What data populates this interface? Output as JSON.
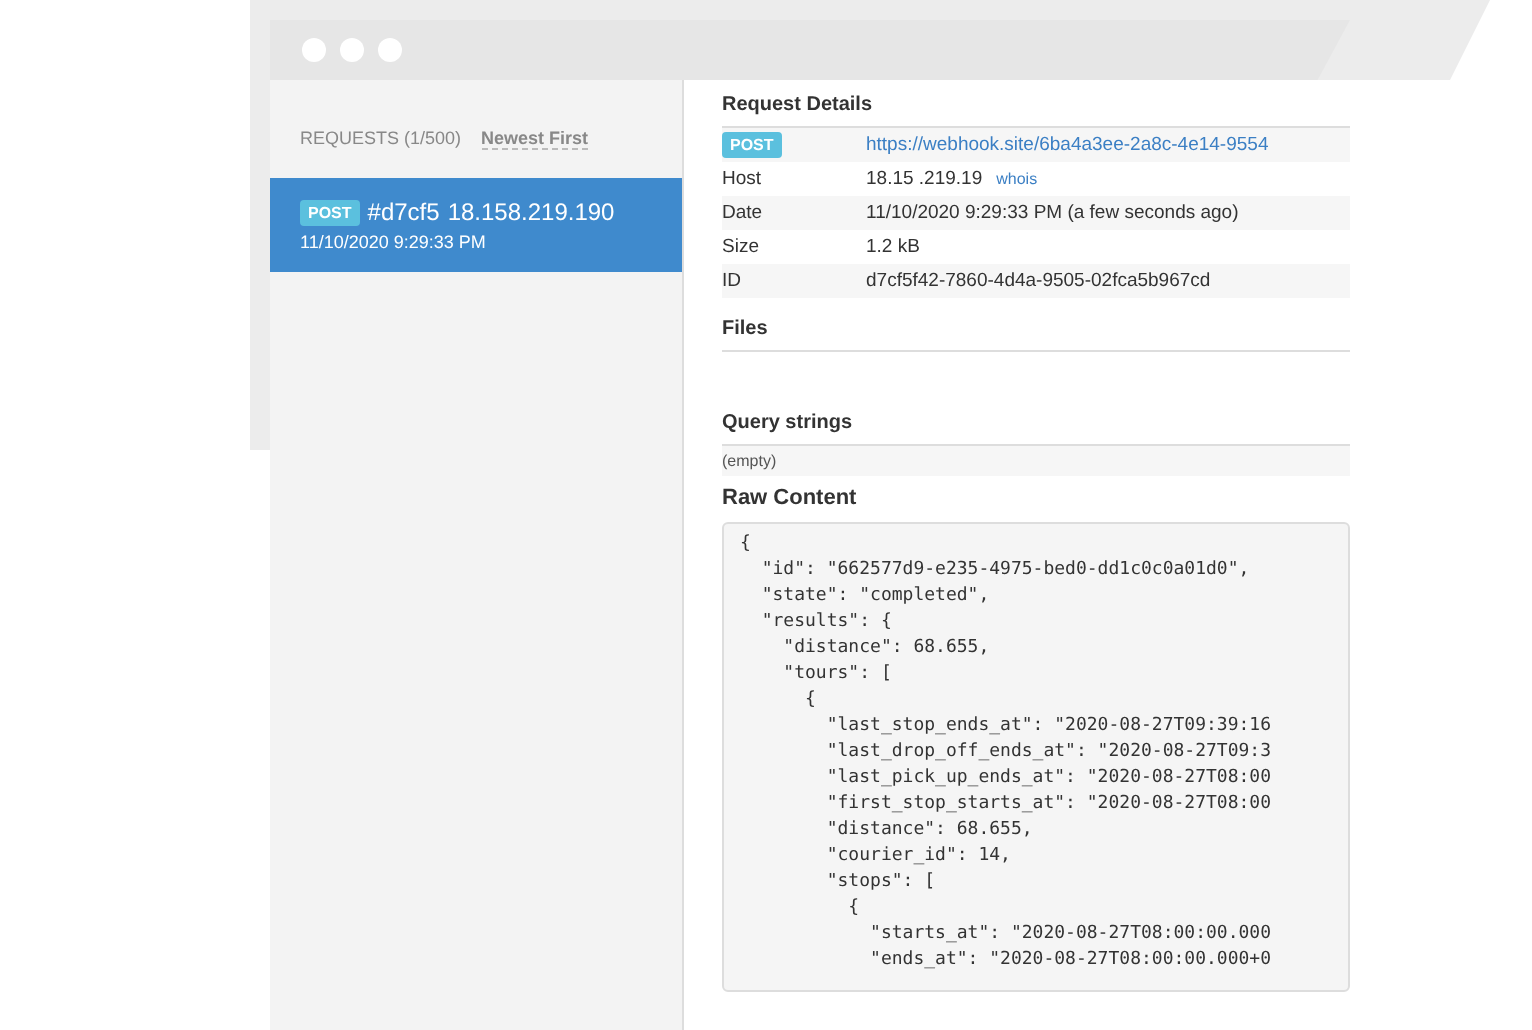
{
  "sidebar": {
    "title": "REQUESTS (1/500)",
    "sort": "Newest First",
    "requests": [
      {
        "method": "POST",
        "id": "#d7cf5",
        "ip": "18.158.219.190",
        "time": "11/10/2020 9:29:33 PM",
        "selected": true
      }
    ]
  },
  "details": {
    "title": "Request Details",
    "method": "POST",
    "url": "https://webhook.site/6ba4a3ee-2a8c-4e14-9554",
    "rows": [
      {
        "label": "Host",
        "value": "18.15 .219.19",
        "link": "whois"
      },
      {
        "label": "Date",
        "value": "11/10/2020 9:29:33 PM (a few seconds ago)"
      },
      {
        "label": "Size",
        "value": "1.2 kB"
      },
      {
        "label": "ID",
        "value": "d7cf5f42-7860-4d4a-9505-02fca5b967cd"
      }
    ]
  },
  "files": {
    "title": "Files"
  },
  "query_strings": {
    "title": "Query strings",
    "value": "(empty)"
  },
  "raw_content": {
    "title": "Raw Content",
    "lines": [
      "{",
      "  \"id\": \"662577d9-e235-4975-bed0-dd1c0c0a01d0\",",
      "  \"state\": \"completed\",",
      "  \"results\": {",
      "    \"distance\": 68.655,",
      "    \"tours\": [",
      "      {",
      "        \"last_stop_ends_at\": \"2020-08-27T09:39:16",
      "        \"last_drop_off_ends_at\": \"2020-08-27T09:3",
      "        \"last_pick_up_ends_at\": \"2020-08-27T08:00",
      "        \"first_stop_starts_at\": \"2020-08-27T08:00",
      "        \"distance\": 68.655,",
      "        \"courier_id\": 14,",
      "        \"stops\": [",
      "          {",
      "            \"starts_at\": \"2020-08-27T08:00:00.000",
      "            \"ends_at\": \"2020-08-27T08:00:00.000+0"
    ]
  }
}
